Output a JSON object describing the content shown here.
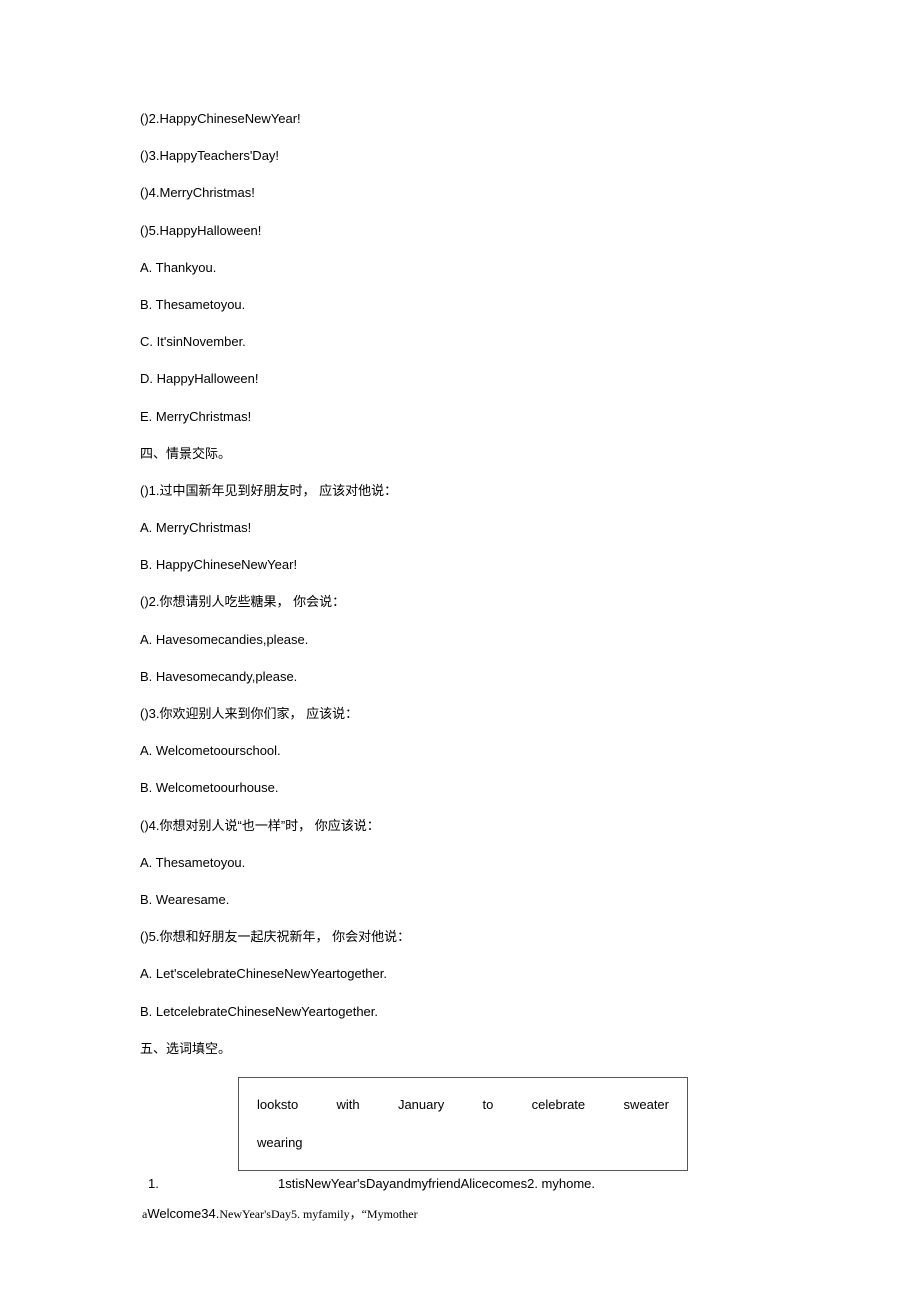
{
  "section3": {
    "items": [
      "()2.HappyChineseNewYear!",
      "()3.HappyTeachers'Day!",
      "()4.MerryChristmas!",
      "()5.HappyHalloween!"
    ],
    "options": [
      "A.  Thankyou.",
      "B.  Thesametoyou.",
      "C.  It'sinNovember.",
      "D.  HappyHalloween!",
      "E.  MerryChristmas!"
    ]
  },
  "section4": {
    "title": "四、情景交际。",
    "questions": [
      {
        "prompt": "()1.过中国新年见到好朋友时， 应该对他说：",
        "a": "A.  MerryChristmas!",
        "b": "B.  HappyChineseNewYear!"
      },
      {
        "prompt": "()2.你想请别人吃些糖果， 你会说：",
        "a": "A.  Havesomecandies,please.",
        "b": "B.  Havesomecandy,please."
      },
      {
        "prompt": "()3.你欢迎别人来到你们家， 应该说：",
        "a": "A.  Welcometoourschool.",
        "b": "B.  Welcometoourhouse."
      },
      {
        "prompt": "()4.你想对别人说“也一样”时， 你应该说：",
        "a": "A.  Thesametoyou.",
        "b": "B.  Wearesame."
      },
      {
        "prompt": "()5.你想和好朋友一起庆祝新年， 你会对他说：",
        "a": "A.  Let'scelebrateChineseNewYeartogether.",
        "b": "B.  LetcelebrateChineseNewYeartogether."
      }
    ]
  },
  "section5": {
    "title": "五、选词填空。",
    "words_row1": [
      "looksto",
      "with",
      "January",
      "to",
      "celebrate",
      "sweater"
    ],
    "words_row2": [
      "wearing"
    ],
    "fill": {
      "num": "1.",
      "text1": "1stisNewYear'sDayandmyfriendAlicecomes2.  myhome.",
      "line2_prefix_small": "a",
      "line2_w1": "Welcome34.",
      "line2_ch1": "NewYear'sDay5.  myfamily，“Mymother"
    }
  }
}
